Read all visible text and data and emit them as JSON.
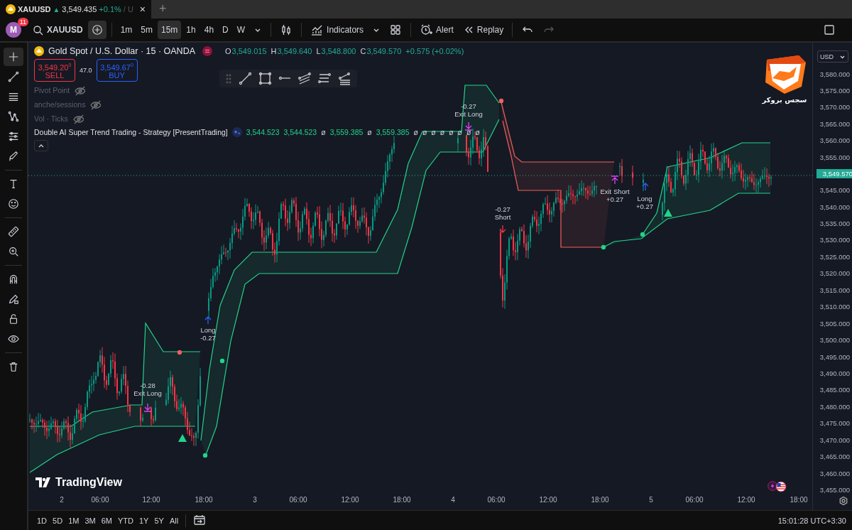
{
  "browser_tab": {
    "symbol": "XAUUSD",
    "direction": "▲",
    "price": "3,549.435",
    "change": "+0.1%",
    "cut_text": "/ U",
    "close": "×"
  },
  "new_tab": "+",
  "toolbar": {
    "avatar": "M",
    "badge": "11",
    "symbol": "XAUUSD",
    "intervals": [
      {
        "label": "1m",
        "selected": false
      },
      {
        "label": "5m",
        "selected": false
      },
      {
        "label": "15m",
        "selected": true
      },
      {
        "label": "1h",
        "selected": false
      },
      {
        "label": "4h",
        "selected": false
      },
      {
        "label": "D",
        "selected": false
      },
      {
        "label": "W",
        "selected": false
      }
    ],
    "indicators": "Indicators",
    "alert": "Alert",
    "replay": "Replay"
  },
  "drawing_tools": [
    {
      "kind": "crosshair",
      "selected": true
    },
    {
      "kind": "trendline",
      "selected": false
    },
    {
      "kind": "hlines",
      "selected": false
    },
    {
      "kind": "pattern",
      "selected": false
    },
    {
      "kind": "fib",
      "selected": false
    },
    {
      "kind": "brush",
      "selected": false
    },
    {
      "kind": "text",
      "selected": false
    },
    {
      "kind": "smiley",
      "selected": false
    },
    {
      "kind": "ruler",
      "selected": false
    },
    {
      "kind": "zoom",
      "selected": false
    },
    {
      "kind": "magnet",
      "selected": false
    },
    {
      "kind": "pencil",
      "selected": false
    },
    {
      "kind": "lock",
      "selected": false
    },
    {
      "kind": "eye",
      "selected": false
    },
    {
      "kind": "trash",
      "selected": false
    }
  ],
  "legend": {
    "title": "Gold Spot / U.S. Dollar · 15 · OANDA",
    "ohlc": [
      {
        "key": "O",
        "value": "3,549.015"
      },
      {
        "key": "H",
        "value": "3,549.640"
      },
      {
        "key": "L",
        "value": "3,548.800"
      },
      {
        "key": "C",
        "value": "3,549.570"
      }
    ],
    "change": "+0.575 (+0.02%)",
    "sell": {
      "price": "3,549.20$^{0}$",
      "label": "SELL"
    },
    "spread": "47.0",
    "buy": {
      "price": "3,549.67$^{0}$",
      "label": "BUY"
    },
    "indicators": [
      {
        "name": "Pivot Point",
        "visible": false
      },
      {
        "name": "anche/sessions",
        "visible": false
      },
      {
        "name": "Vol · Ticks",
        "visible": false
      }
    ],
    "strategy": {
      "name": "Double AI Super Trend Trading - Strategy [PresentTrading]",
      "values": [
        {
          "kind": "value",
          "text": "3,544.523"
        },
        {
          "kind": "value",
          "text": "3,544.523"
        },
        {
          "kind": "na",
          "text": "ø"
        },
        {
          "kind": "value",
          "text": "3,559.385"
        },
        {
          "kind": "na",
          "text": "ø"
        },
        {
          "kind": "value",
          "text": "3,559.385"
        },
        {
          "kind": "na",
          "text": "ø"
        },
        {
          "kind": "na",
          "text": "ø"
        },
        {
          "kind": "na",
          "text": "ø"
        },
        {
          "kind": "na",
          "text": "ø"
        },
        {
          "kind": "na",
          "text": "ø"
        },
        {
          "kind": "na",
          "text": "ø"
        },
        {
          "kind": "na",
          "text": "ø"
        },
        {
          "kind": "na",
          "text": "ø"
        }
      ]
    }
  },
  "broker_logo": {
    "text": "سجس بروکر"
  },
  "trades": [
    {
      "kind": "exit-long",
      "lines": [
        "-0.28",
        "Exit Long"
      ]
    },
    {
      "kind": "long",
      "lines": [
        "Long",
        "-0.27"
      ]
    },
    {
      "kind": "exit-long",
      "lines": [
        "-0.27",
        "Exit Long"
      ]
    },
    {
      "kind": "short",
      "lines": [
        "-0.27",
        "Short"
      ]
    },
    {
      "kind": "exit-short",
      "lines": [
        "Exit Short",
        "+0.27"
      ]
    },
    {
      "kind": "long",
      "lines": [
        "Long",
        "+0.27"
      ]
    }
  ],
  "watermark": {
    "text": "TradingView"
  },
  "price_axis": {
    "currency": "USD",
    "current": "3,549.570",
    "labels": [
      "3,580.000",
      "3,575.000",
      "3,570.000",
      "3,565.000",
      "3,560.000",
      "3,555.000",
      "3,545.000",
      "3,540.000",
      "3,535.000",
      "3,530.000",
      "3,525.000",
      "3,520.000",
      "3,515.000",
      "3,510.000",
      "3,505.000",
      "3,500.000",
      "3,495.000",
      "3,490.000",
      "3,485.000",
      "3,480.000",
      "3,475.000",
      "3,470.000",
      "3,465.000",
      "3,460.000",
      "3,455.000"
    ]
  },
  "time_axis": [
    "2",
    "06:00",
    "12:00",
    "18:00",
    "3",
    "06:00",
    "12:00",
    "18:00",
    "4",
    "06:00",
    "12:00",
    "18:00",
    "5",
    "06:00",
    "12:00",
    "18:00"
  ],
  "ranges": [
    "1D",
    "5D",
    "1M",
    "3M",
    "6M",
    "YTD",
    "1Y",
    "5Y",
    "All"
  ],
  "clock": "15:01:28 UTC+3:30"
}
